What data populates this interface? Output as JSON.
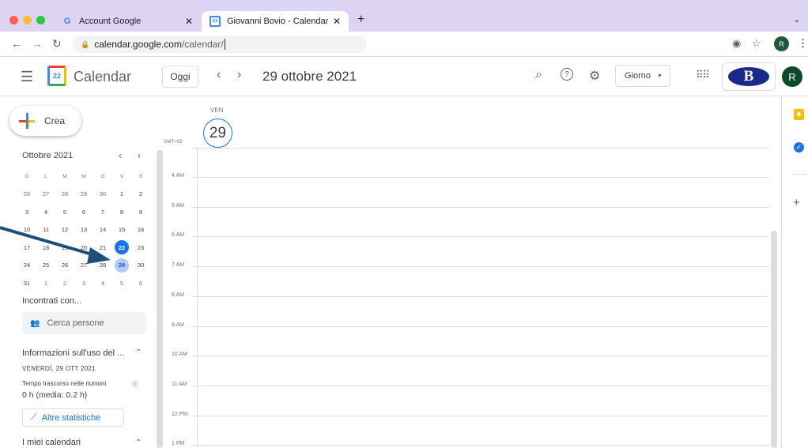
{
  "browser": {
    "tabs": [
      {
        "label": "Account Google",
        "favicon": "G"
      },
      {
        "label": "Giovanni Bovio - Calendario - ",
        "favicon": "22"
      }
    ],
    "url_domain": "calendar.google.com",
    "url_path": "/calendar/",
    "profile_initial": "R"
  },
  "header": {
    "app_title": "Calendar",
    "logo_day": "22",
    "today_label": "Oggi",
    "date_title": "29 ottobre 2021",
    "view_label": "Giorno",
    "brand_letter": "B",
    "avatar_initial": "R"
  },
  "sidebar": {
    "create_label": "Crea",
    "month_label": "Ottobre 2021",
    "weekday_headers": [
      "D",
      "L",
      "M",
      "M",
      "G",
      "V",
      "S"
    ],
    "weeks": [
      [
        "26",
        "27",
        "28",
        "29",
        "30",
        "1",
        "2"
      ],
      [
        "3",
        "4",
        "5",
        "6",
        "7",
        "8",
        "9"
      ],
      [
        "10",
        "11",
        "12",
        "13",
        "14",
        "15",
        "16"
      ],
      [
        "17",
        "18",
        "19",
        "20",
        "21",
        "22",
        "23"
      ],
      [
        "24",
        "25",
        "26",
        "27",
        "28",
        "29",
        "30"
      ],
      [
        "31",
        "1",
        "2",
        "3",
        "4",
        "5",
        "6"
      ]
    ],
    "today_day": "22",
    "selected_day": "29",
    "meet_heading": "Incontrati con...",
    "search_people_placeholder": "Cerca persone",
    "insights_heading": "Informazioni sull'uso del ...",
    "insights_date": "VENERDÌ, 29 OTT 2021",
    "meeting_time_label": "Tempo trascorso nelle riunioni",
    "meeting_time_value": "0 h (media: 0.2 h)",
    "stats_button": "Altre statistiche",
    "my_calendars_heading": "I miei calendari"
  },
  "main": {
    "day_name": "VEN",
    "day_number": "29",
    "timezone": "GMT+02",
    "hours": [
      "4 AM",
      "5 AM",
      "6 AM",
      "7 AM",
      "8 AM",
      "9 AM",
      "10 AM",
      "11 AM",
      "12 PM",
      "1 PM"
    ]
  },
  "colors": {
    "accent": "#1a73e8",
    "selected_bg": "#aecbfa",
    "tabbar": "#ddd3f2",
    "annotation_arrow": "#1f4e79"
  }
}
